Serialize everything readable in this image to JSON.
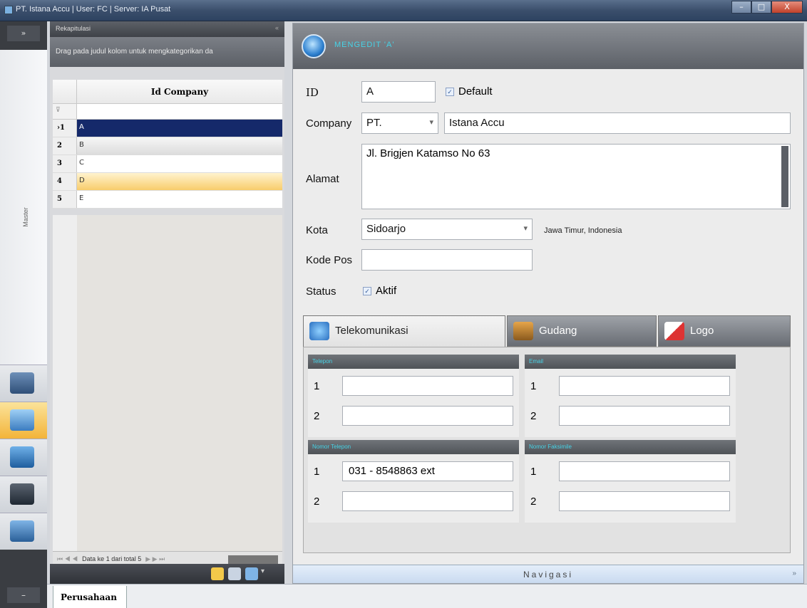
{
  "window": {
    "title": "PT. Istana Accu  |  User: FC  |  Server: IA Pusat",
    "minimize": "–",
    "maximize": "□",
    "close": "X"
  },
  "sidebar": {
    "expand": "»",
    "master_label": "Master",
    "collapse": "–"
  },
  "rekap": {
    "title": "Rekapitulasi",
    "group_hint": "Drag pada judul kolom untuk mengkategorikan da",
    "column": "Id Company",
    "filter_icon": "⊽",
    "rows": [
      {
        "num": "1",
        "id": "A",
        "indicator": "›"
      },
      {
        "num": "2",
        "id": "B",
        "indicator": ""
      },
      {
        "num": "3",
        "id": "C",
        "indicator": ""
      },
      {
        "num": "4",
        "id": "D",
        "indicator": ""
      },
      {
        "num": "5",
        "id": "E",
        "indicator": ""
      }
    ],
    "pager_text": "Data ke 1 dari total 5",
    "pager_first": "⏮ ◀ ◀",
    "pager_last": "▶ ▶ ⏭"
  },
  "form": {
    "header_title": "MENGEDIT 'A'",
    "id_label": "ID",
    "id_value": "A",
    "default_label": "Default",
    "company_label": "Company",
    "company_prefix": "PT.",
    "company_name": "Istana Accu",
    "alamat_label": "Alamat",
    "alamat_value": "Jl. Brigjen Katamso No 63",
    "kota_label": "Kota",
    "kota_value": "Sidoarjo",
    "kota_info": "Jawa Timur, Indonesia",
    "kodepos_label": "Kode Pos",
    "kodepos_value": "",
    "status_label": "Status",
    "aktif_label": "Aktif"
  },
  "tabs": [
    {
      "label": "Telekomunikasi",
      "icon": "telecom-icon"
    },
    {
      "label": "Gudang",
      "icon": "warehouse-icon"
    },
    {
      "label": "Logo",
      "icon": "logo-icon"
    }
  ],
  "groups": [
    {
      "title": "Telepon",
      "rows": [
        {
          "num": "1",
          "value": ""
        },
        {
          "num": "2",
          "value": ""
        }
      ]
    },
    {
      "title": "Email",
      "rows": [
        {
          "num": "1",
          "value": ""
        },
        {
          "num": "2",
          "value": ""
        }
      ]
    },
    {
      "title": "Nomor Telepon",
      "rows": [
        {
          "num": "1",
          "value": "031 - 8548863  ext"
        },
        {
          "num": "2",
          "value": ""
        }
      ]
    },
    {
      "title": "Nomor Faksimile",
      "rows": [
        {
          "num": "1",
          "value": ""
        },
        {
          "num": "2",
          "value": ""
        }
      ]
    }
  ],
  "navigasi": "Navigasi",
  "navigasi_chevron": "»",
  "bottom_tab": "Perusahaan",
  "dropdown_arrow": "▾",
  "check_mark": "✓"
}
